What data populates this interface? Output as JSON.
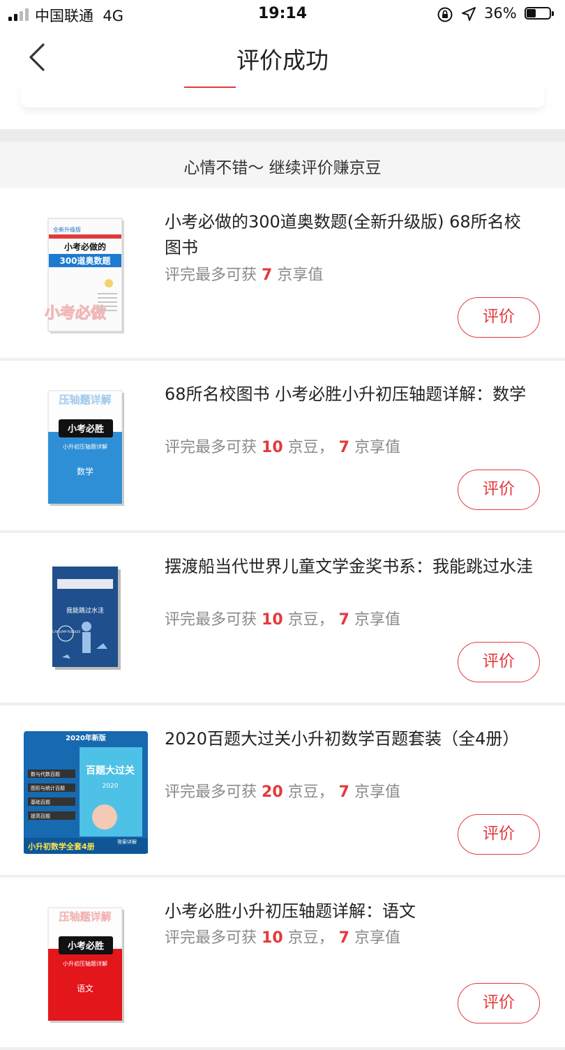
{
  "status_bar": {
    "carrier": "中国联通",
    "network": "4G",
    "time": "19:14",
    "battery": "36%"
  },
  "nav": {
    "title": "评价成功",
    "back_icon": "chevron-left-icon"
  },
  "prompt": "心情不错～ 继续评价赚京豆",
  "colors": {
    "accent": "#e4393c",
    "reward_gray": "#8a8a8a"
  },
  "products": [
    {
      "title": "小考必做的300道奥数题(全新升级版) 68所名校图书",
      "reward_prefix": "评完最多可获",
      "beans": "",
      "beans_unit": "",
      "value": "7",
      "value_unit": "京享值",
      "button": "评价",
      "cover": {
        "ribbon": "全新升级版",
        "title_line1": "小考必做的",
        "title_line2": "300道奥数题",
        "watermark": "小考必做"
      }
    },
    {
      "title": "68所名校图书 小考必胜小升初压轴题详解：数学",
      "reward_prefix": "评完最多可获",
      "beans": "10",
      "beans_unit": "京豆，",
      "value": "7",
      "value_unit": "京享值",
      "button": "评价",
      "cover": {
        "top": "压轴题详解",
        "band": "小考必胜",
        "sub": "小升初压轴题详解",
        "subject": "数学"
      }
    },
    {
      "title": "摆渡船当代世界儿童文学金奖书系：我能跳过水洼",
      "reward_prefix": "评完最多可获",
      "beans": "10",
      "beans_unit": "京豆，",
      "value": "7",
      "value_unit": "京享值",
      "button": "评价",
      "cover": {
        "title": "我能跳过水洼",
        "badge": "I CAN JUMP PUDDLES"
      }
    },
    {
      "title": "2020百题大过关小升初数学百题套装（全4册）",
      "reward_prefix": "评完最多可获",
      "beans": "20",
      "beans_unit": "京豆，",
      "value": "7",
      "value_unit": "京享值",
      "button": "评价",
      "cover": {
        "ribbon": "2020年新版",
        "tags": [
          "数与代数百题",
          "图形与统计百题",
          "基础百题",
          "提高百题"
        ],
        "book_title": "百题大过关",
        "year": "2020",
        "bottom": "小升初数学全套4册",
        "answer": "答案详解"
      }
    },
    {
      "title": "小考必胜小升初压轴题详解：语文",
      "reward_prefix": "评完最多可获",
      "beans": "10",
      "beans_unit": "京豆，",
      "value": "7",
      "value_unit": "京享值",
      "button": "评价",
      "cover": {
        "top": "压轴题详解",
        "band": "小考必胜",
        "sub": "小升初压轴题详解",
        "subject": "语文"
      }
    }
  ]
}
